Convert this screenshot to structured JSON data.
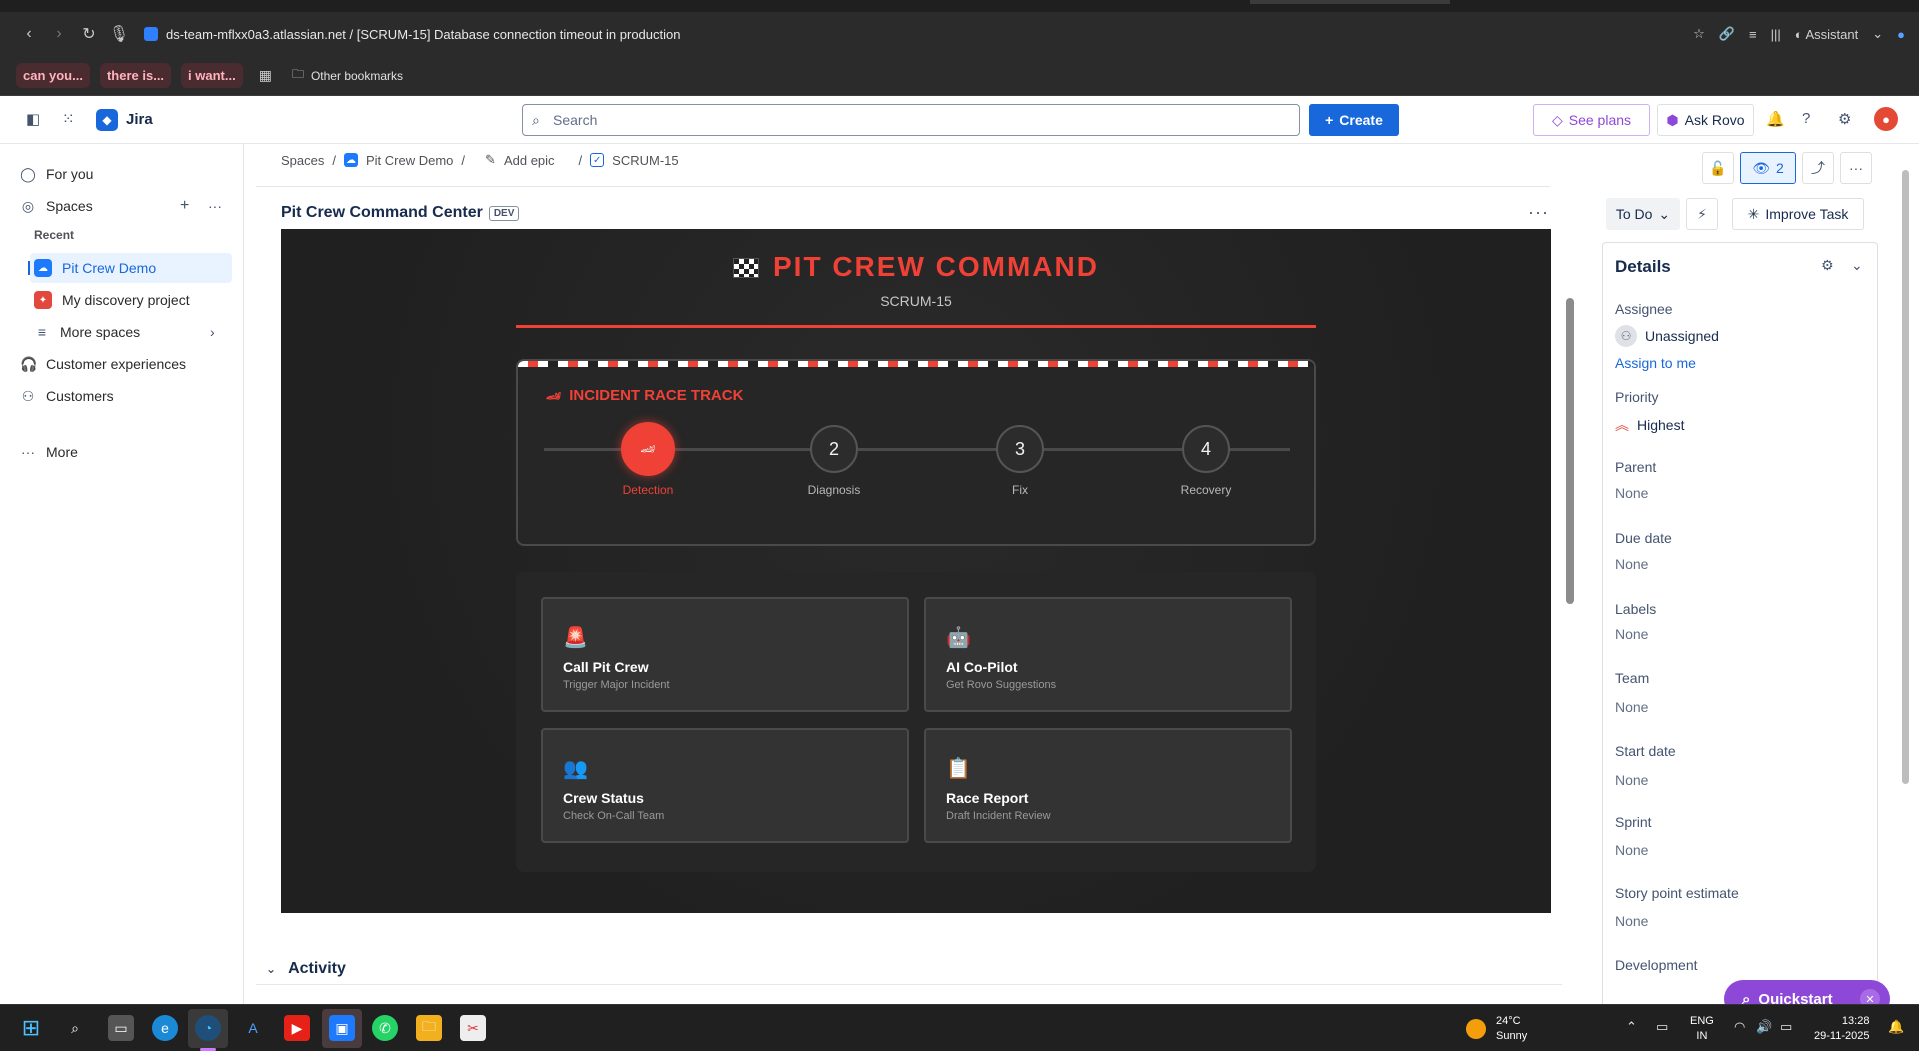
{
  "browser": {
    "url": "ds-team-mflxx0a3.atlassian.net / [SCRUM-15] Database connection timeout in production",
    "assistant_label": "Assistant",
    "bookmarks": [
      "can you...",
      "there is...",
      "i want..."
    ],
    "other_bookmarks": "Other bookmarks"
  },
  "topnav": {
    "product": "Jira",
    "search_placeholder": "Search",
    "create_label": "Create",
    "see_plans_label": "See plans",
    "ask_rovo_label": "Ask Rovo"
  },
  "sidebar": {
    "for_you": "For you",
    "spaces": "Spaces",
    "recent_header": "Recent",
    "projects": [
      "Pit Crew Demo",
      "My discovery project"
    ],
    "more_spaces": "More spaces",
    "customer_experiences": "Customer experiences",
    "customers": "Customers",
    "more": "More"
  },
  "breadcrumb": {
    "spaces": "Spaces",
    "project": "Pit Crew Demo",
    "add_epic": "Add epic",
    "issue_key": "SCRUM-15"
  },
  "app": {
    "title": "Pit Crew Command Center",
    "badge": "DEV",
    "heading": "PIT CREW COMMAND",
    "subheading": "SCRUM-15",
    "track_title": "INCIDENT RACE TRACK",
    "stages": [
      {
        "num": "",
        "label": "Detection",
        "active": true
      },
      {
        "num": "2",
        "label": "Diagnosis",
        "active": false
      },
      {
        "num": "3",
        "label": "Fix",
        "active": false
      },
      {
        "num": "4",
        "label": "Recovery",
        "active": false
      }
    ],
    "cards": [
      {
        "icon": "siren-icon",
        "glyph": "🚨",
        "title": "Call Pit Crew",
        "subtitle": "Trigger Major Incident"
      },
      {
        "icon": "robot-icon",
        "glyph": "🤖",
        "title": "AI Co-Pilot",
        "subtitle": "Get Rovo Suggestions"
      },
      {
        "icon": "people-icon",
        "glyph": "👥",
        "title": "Crew Status",
        "subtitle": "Check On-Call Team"
      },
      {
        "icon": "clipboard-icon",
        "glyph": "📋",
        "title": "Race Report",
        "subtitle": "Draft Incident Review"
      }
    ],
    "accent_color": "#ef4136"
  },
  "activity_label": "Activity",
  "right_panel": {
    "watchers_count": "2",
    "status": "To Do",
    "improve_task": "Improve Task",
    "details_title": "Details",
    "fields": {
      "assignee_label": "Assignee",
      "assignee_value": "Unassigned",
      "assign_to_me": "Assign to me",
      "priority_label": "Priority",
      "priority_value": "Highest",
      "parent_label": "Parent",
      "parent_value": "None",
      "due_date_label": "Due date",
      "due_date_value": "None",
      "labels_label": "Labels",
      "labels_value": "None",
      "team_label": "Team",
      "team_value": "None",
      "start_date_label": "Start date",
      "start_date_value": "None",
      "sprint_label": "Sprint",
      "sprint_value": "None",
      "story_points_label": "Story point estimate",
      "story_points_value": "None",
      "development_label": "Development"
    },
    "quickstart": "Quickstart"
  },
  "taskbar": {
    "temperature": "24°C",
    "weather": "Sunny",
    "lang_top": "ENG",
    "lang_bottom": "IN",
    "time": "13:28",
    "date": "29-11-2025"
  }
}
